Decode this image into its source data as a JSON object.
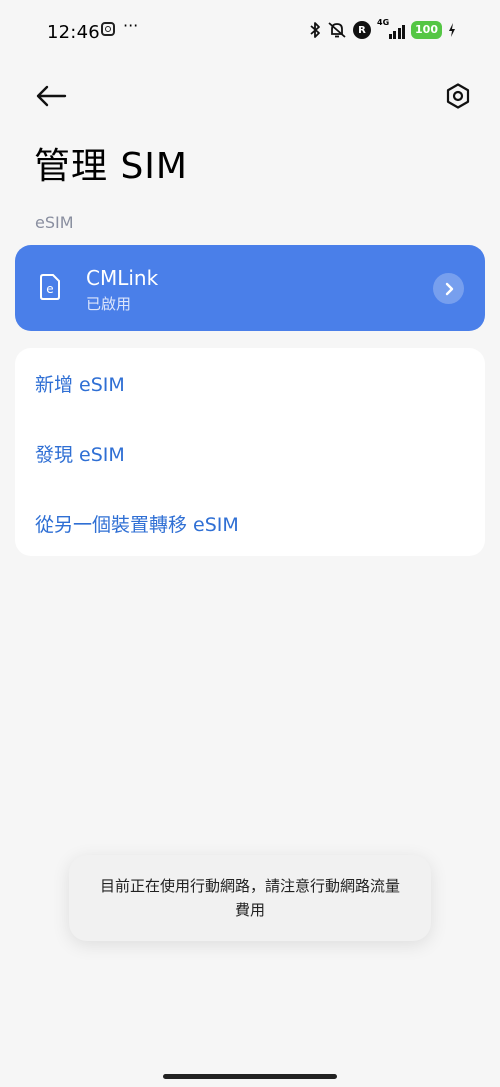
{
  "status_bar": {
    "time": "12:46",
    "more": "···",
    "battery": "100",
    "network": "4G",
    "roaming": "R"
  },
  "header": {
    "title": "管理 SIM"
  },
  "esim_section": {
    "label": "eSIM",
    "card": {
      "name": "CMLink",
      "status": "已啟用"
    }
  },
  "options": [
    {
      "label": "新增 eSIM"
    },
    {
      "label": "發現 eSIM"
    },
    {
      "label": "從另一個裝置轉移 eSIM"
    }
  ],
  "toast": {
    "message": "目前正在使用行動網路，請注意行動網路流量費用"
  },
  "colors": {
    "accent": "#4a7fe9",
    "link": "#2f6fd4",
    "background": "#f6f6f6"
  }
}
